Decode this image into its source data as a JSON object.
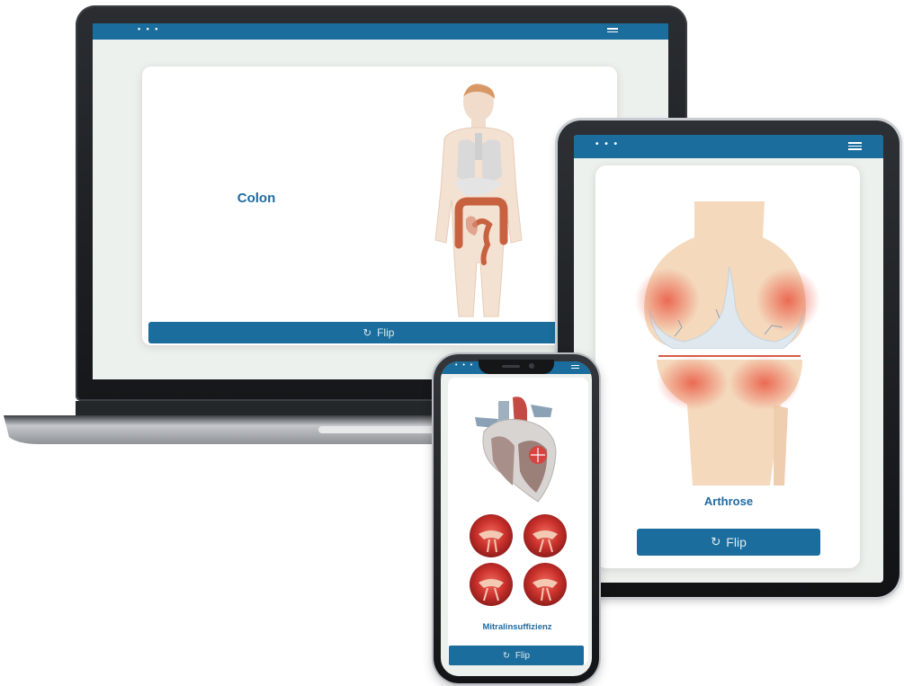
{
  "laptop": {
    "dots": "• • •",
    "card_title": "Colon",
    "flip_label": "Flip",
    "flip_icon": "↻"
  },
  "tablet": {
    "dots": "• • •",
    "card_title": "Arthrose",
    "flip_label": "Flip",
    "flip_icon": "↻"
  },
  "phone": {
    "dots": "• • •",
    "card_title": "Mitralinsuffizienz",
    "flip_label": "Flip",
    "flip_icon": "↻"
  },
  "colors": {
    "brand_blue": "#1a6d9c",
    "title_blue": "#1f6aa0",
    "screen_bg": "#edf1ee",
    "card_bg": "#ffffff"
  },
  "icons": [
    "menu-icon",
    "flip-icon",
    "dots-icon"
  ]
}
